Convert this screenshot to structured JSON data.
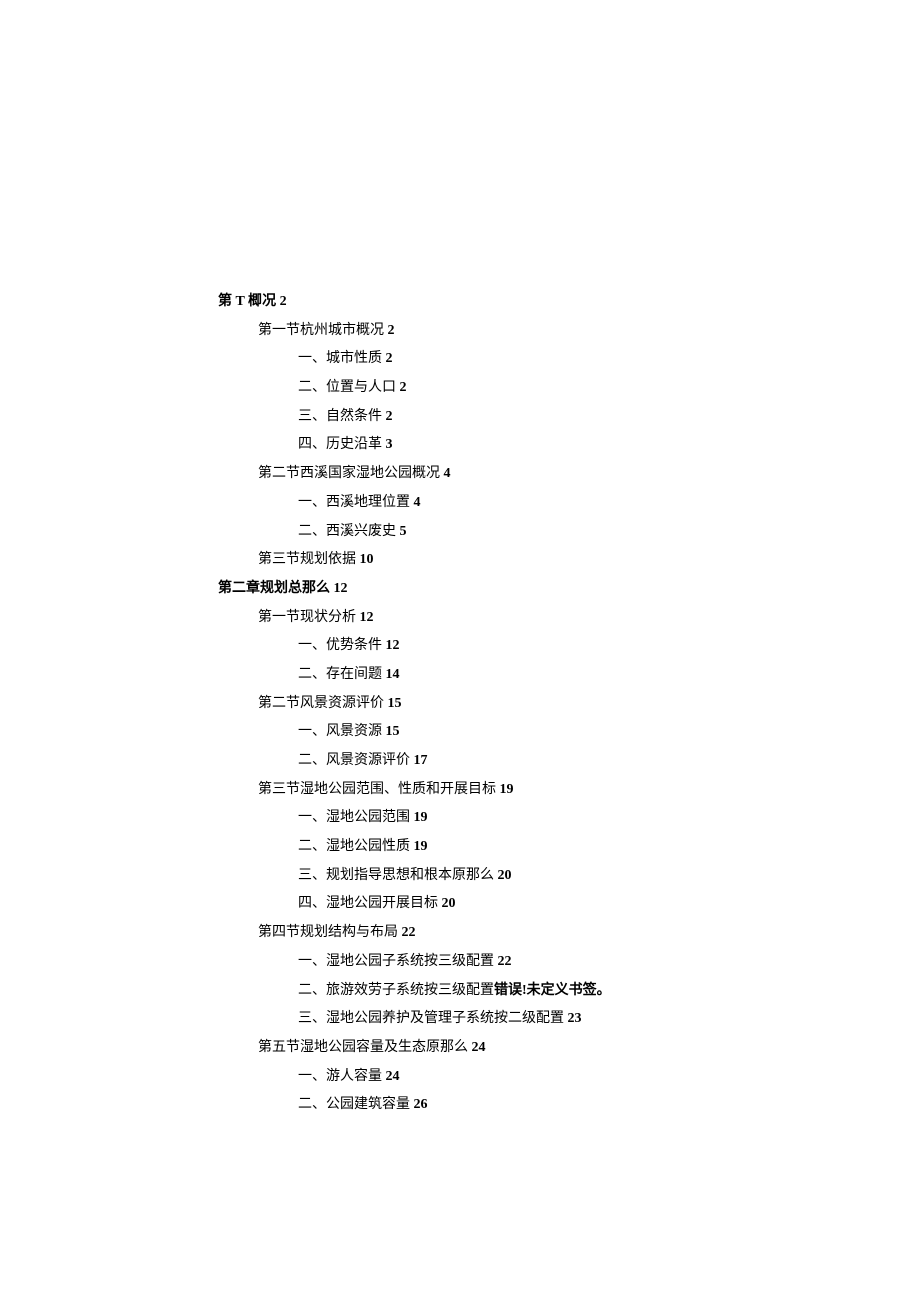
{
  "entries": [
    {
      "level": 0,
      "text": "第 T 楖况 ",
      "page": "2"
    },
    {
      "level": 1,
      "text": "第一节杭州城市概况 ",
      "page": "2"
    },
    {
      "level": 2,
      "text": "一、城市性质 ",
      "page": "2"
    },
    {
      "level": 2,
      "text": "二、位置与人口 ",
      "page": "2"
    },
    {
      "level": 2,
      "text": "三、自然条件 ",
      "page": "2"
    },
    {
      "level": 2,
      "text": "四、历史沿革 ",
      "page": "3"
    },
    {
      "level": 1,
      "text": "第二节西溪国家湿地公园概况 ",
      "page": "4"
    },
    {
      "level": 2,
      "text": "一、西溪地理位置 ",
      "page": "4"
    },
    {
      "level": 2,
      "text": "二、西溪兴废史 ",
      "page": "5"
    },
    {
      "level": 1,
      "text": "第三节规划依据 ",
      "page": "10"
    },
    {
      "level": 0,
      "text": "第二章规划总那么 ",
      "page": "12"
    },
    {
      "level": 1,
      "text": "第一节现状分析 ",
      "page": "12"
    },
    {
      "level": 2,
      "text": "一、优势条件 ",
      "page": "12"
    },
    {
      "level": 2,
      "text": "二、存在间题 ",
      "page": "14"
    },
    {
      "level": 1,
      "text": "第二节风景资源评价 ",
      "page": "15"
    },
    {
      "level": 2,
      "text": "一、风景资源 ",
      "page": "15"
    },
    {
      "level": 2,
      "text": "二、风景资源评价 ",
      "page": "17"
    },
    {
      "level": 1,
      "text": "第三节湿地公园范围、性质和开展目标 ",
      "page": "19"
    },
    {
      "level": 2,
      "text": "一、湿地公园范围 ",
      "page": "19"
    },
    {
      "level": 2,
      "text": "二、湿地公园性质 ",
      "page": "19"
    },
    {
      "level": 2,
      "text": "三、规划指导思想和根本原那么 ",
      "page": "20"
    },
    {
      "level": 2,
      "text": "四、湿地公园开展目标 ",
      "page": "20"
    },
    {
      "level": 1,
      "text": "第四节规划结构与布局 ",
      "page": "22"
    },
    {
      "level": 2,
      "text": "一、湿地公园子系统按三级配置 ",
      "page": "22"
    },
    {
      "level": 2,
      "text": "二、旅游效劳子系统按三级配置",
      "error": "错误!未定义书签。"
    },
    {
      "level": 2,
      "text": "三、湿地公园养护及管理子系统按二级配置 ",
      "page": "23"
    },
    {
      "level": 1,
      "text": "第五节湿地公园容量及生态原那么 ",
      "page": "24"
    },
    {
      "level": 2,
      "text": "一、游人容量 ",
      "page": "24"
    },
    {
      "level": 2,
      "text": "二、公园建筑容量 ",
      "page": "26"
    }
  ]
}
